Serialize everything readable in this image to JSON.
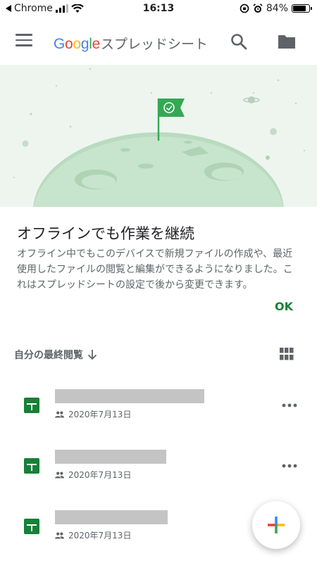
{
  "status_bar": {
    "back_app": "Chrome",
    "time": "16:13",
    "battery_percent": "84%",
    "battery_level": 0.84
  },
  "app_bar": {
    "brand_google": "Google",
    "product_name": "スプレッドシート",
    "icons": [
      "hamburger-menu-icon",
      "search-icon",
      "folder-icon"
    ]
  },
  "offline_card": {
    "title": "オフラインでも作業を継続",
    "body": "オフライン中でもこのデバイスで新規ファイルの作成や、最近使用したファイルの閲覧と編集ができるようになりました。これはスプレッドシートの設定で後から変更できます。",
    "ok_label": "OK",
    "accent_color": "#188038"
  },
  "file_list": {
    "sort_label": "自分の最終閲覧",
    "sort_direction_icon": "arrow-down-icon",
    "view_toggle_icon": "grid-view-icon",
    "files": [
      {
        "modified": "2020年7月13日",
        "shared_icon": "people-icon",
        "file_icon": "sheets-icon",
        "menu_icon": "more-horizontal-icon"
      },
      {
        "modified": "2020年7月13日",
        "shared_icon": "people-icon",
        "file_icon": "sheets-icon",
        "menu_icon": "more-horizontal-icon"
      },
      {
        "modified": "2020年7月13日",
        "shared_icon": "people-icon",
        "file_icon": "sheets-icon",
        "menu_icon": "more-horizontal-icon"
      }
    ]
  },
  "fab": {
    "icon": "colorful-plus-icon"
  }
}
